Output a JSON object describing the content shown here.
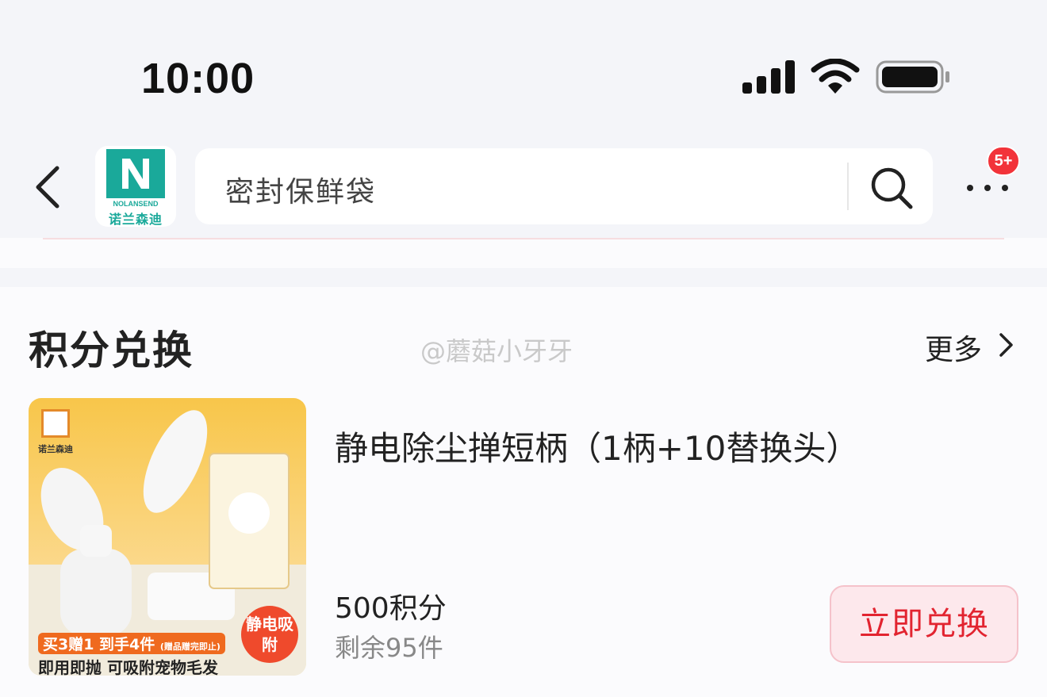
{
  "status_bar": {
    "time": "10:00"
  },
  "nav": {
    "search_placeholder": "密封保鲜袋",
    "notification_badge": "5+",
    "shop_logo": {
      "brand_en": "NOLANSEND",
      "brand_cn": "诺兰森迪"
    }
  },
  "section": {
    "title": "积分兑换",
    "more_label": "更多",
    "watermark": "@蘑菇小牙牙"
  },
  "product": {
    "name": "静电除尘掸短柄（1柄+10替换头）",
    "points": "500积分",
    "stock": "剩余95件",
    "button_label": "立即兑换",
    "image": {
      "brand_cn": "诺兰森迪",
      "promo_line1": "买3赠1 到手4件",
      "promo_note": "(赠品赠完即止)",
      "promo_line2": "即用即抛 可吸附宠物毛发",
      "badge": "静电吸附"
    }
  },
  "colors": {
    "accent": "#e22430",
    "badge": "#f2333a",
    "brand": "#1aa99a"
  }
}
